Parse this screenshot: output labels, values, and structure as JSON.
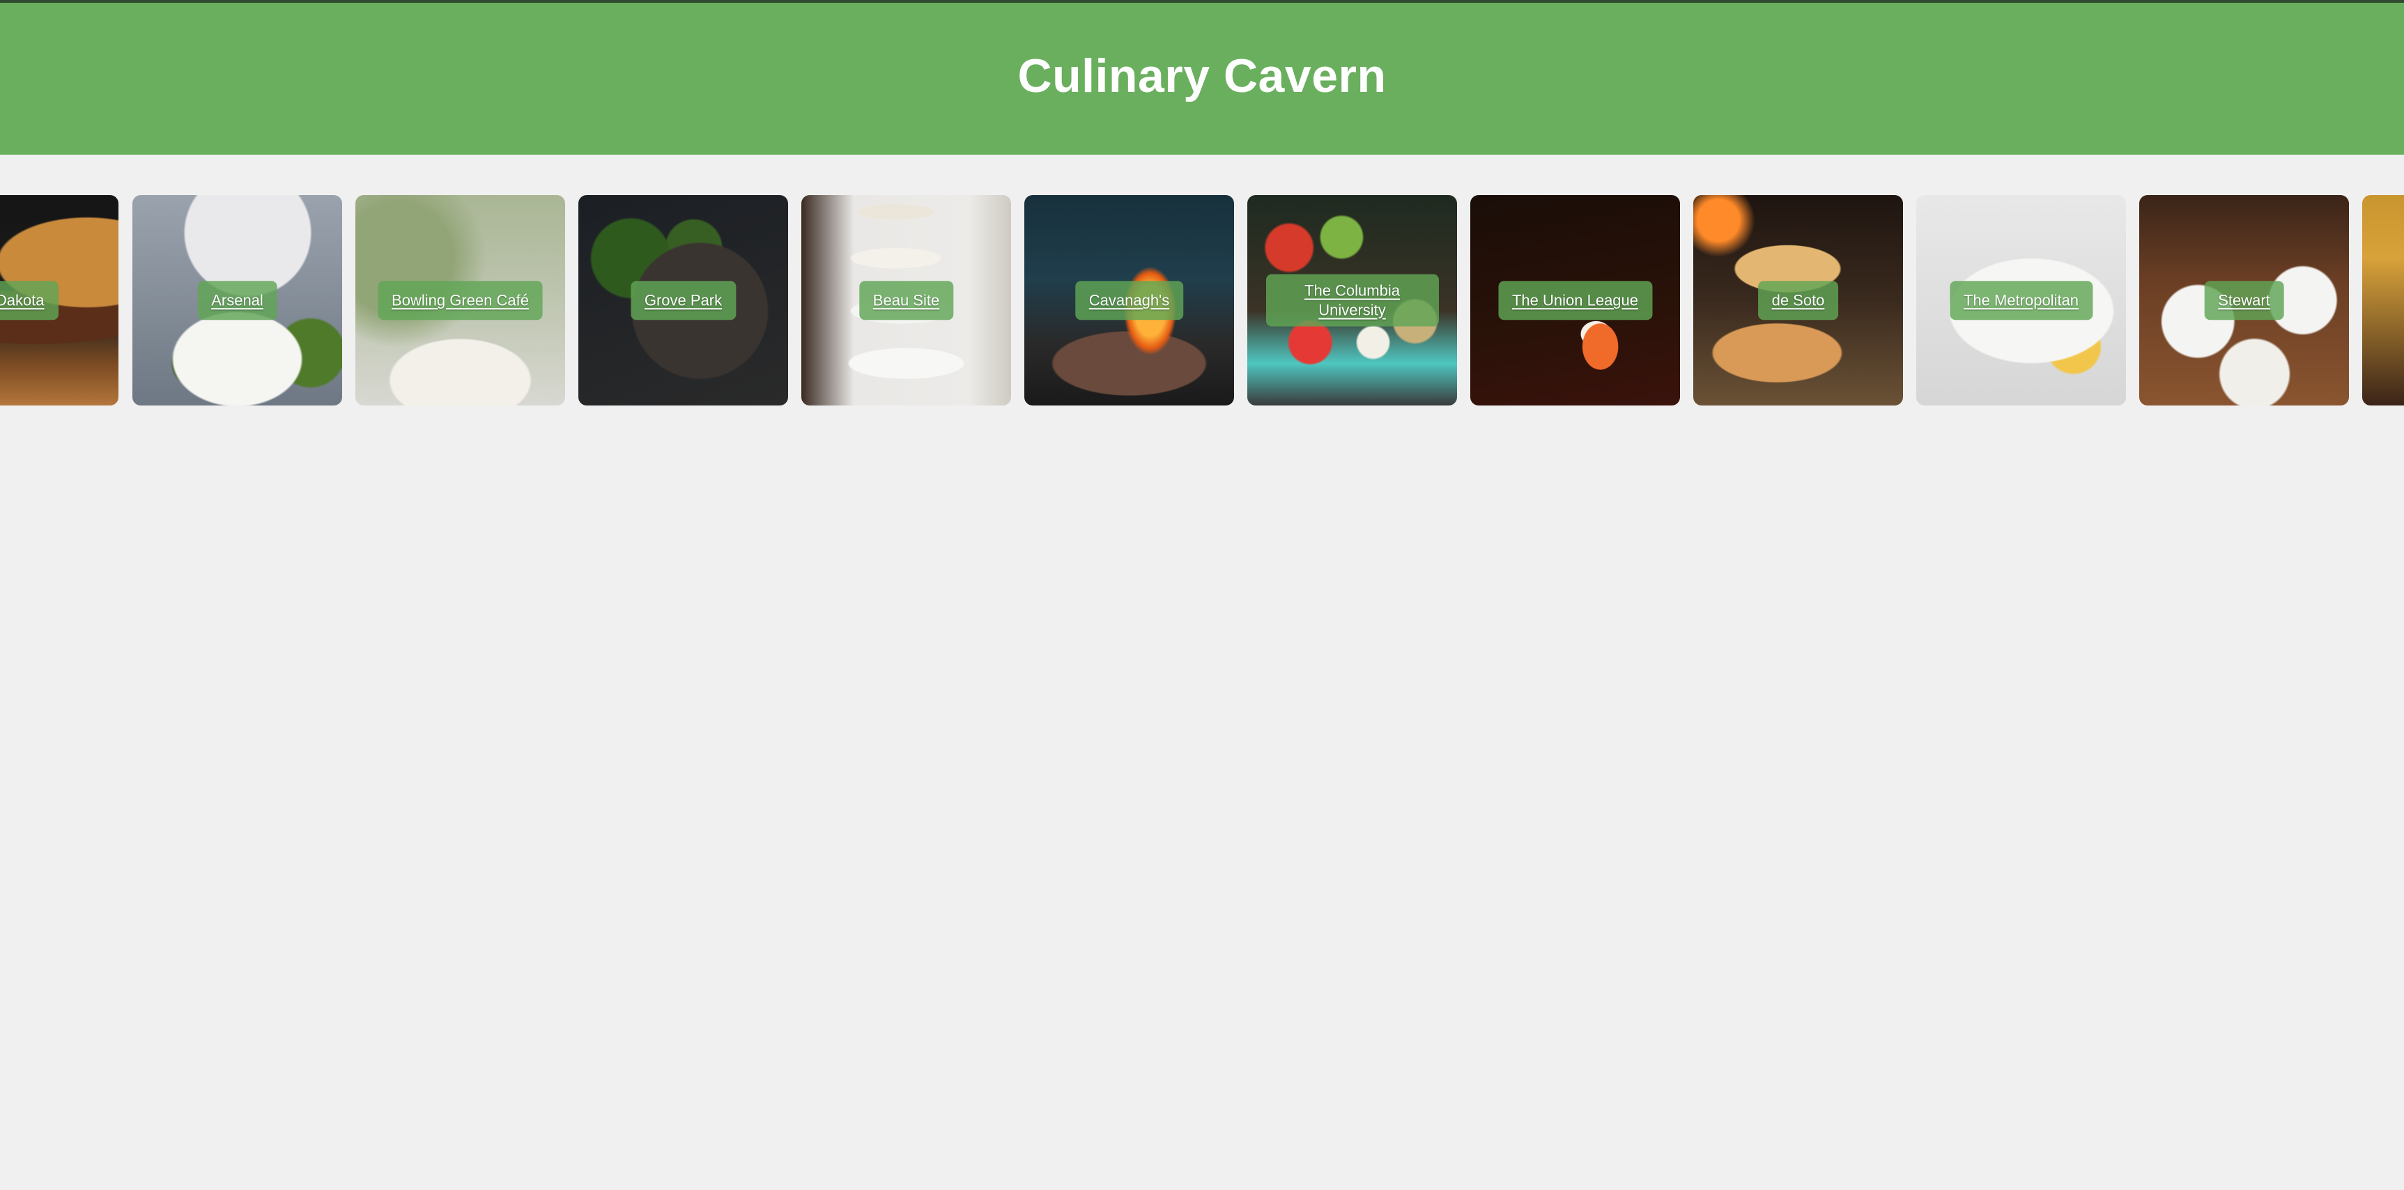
{
  "header": {
    "title": "Culinary Cavern",
    "background_color": "#6aaf5e"
  },
  "cards": [
    {
      "label": "h Dakota",
      "image": "burger-photo"
    },
    {
      "label": "Arsenal",
      "image": "salad-and-potatoes-photo"
    },
    {
      "label": "Bowling Green Café",
      "image": "pasta-bowl-photo"
    },
    {
      "label": "Grove Park",
      "image": "lentils-and-greens-photo"
    },
    {
      "label": "Beau Site",
      "image": "banquet-table-photo"
    },
    {
      "label": "Cavanagh's",
      "image": "grill-fire-photo"
    },
    {
      "label": "The Columbia University",
      "image": "vegetable-prep-photo"
    },
    {
      "label": "The Union League",
      "image": "sushi-chopsticks-photo"
    },
    {
      "label": "de Soto",
      "image": "pizzas-photo"
    },
    {
      "label": "The Metropolitan",
      "image": "steak-plate-photo"
    },
    {
      "label": "Stewart",
      "image": "table-spread-photo"
    }
  ]
}
